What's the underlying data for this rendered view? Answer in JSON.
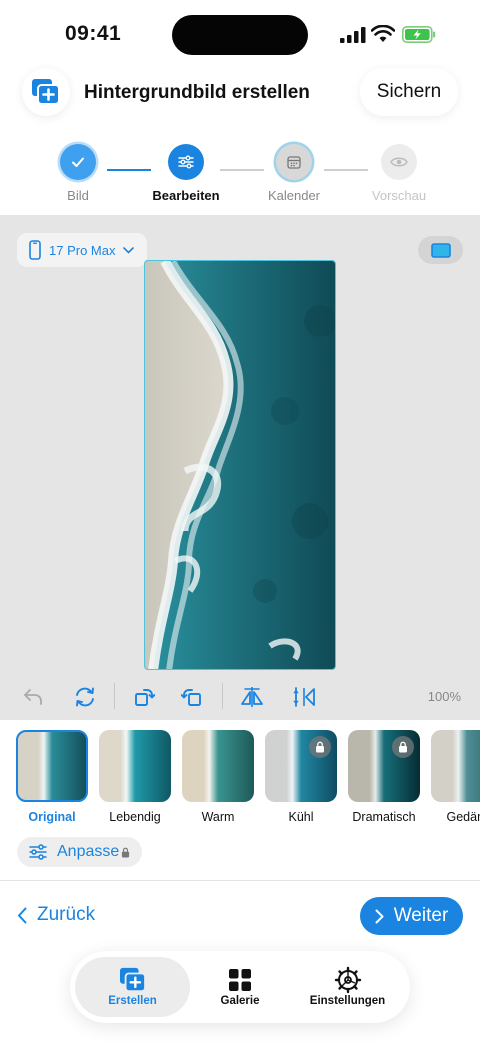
{
  "status": {
    "time": "09:41"
  },
  "header": {
    "title": "Hintergrundbild erstellen",
    "save_label": "Sichern"
  },
  "steps": [
    {
      "label": "Bild",
      "state": "done"
    },
    {
      "label": "Bearbeiten",
      "state": "active"
    },
    {
      "label": "Kalender",
      "state": "pending"
    },
    {
      "label": "Vorschau",
      "state": "disabled"
    }
  ],
  "editor": {
    "device": "17 Pro Max",
    "zoom": "100%"
  },
  "filters": [
    {
      "label": "Original",
      "selected": true,
      "locked": false
    },
    {
      "label": "Lebendig",
      "selected": false,
      "locked": false
    },
    {
      "label": "Warm",
      "selected": false,
      "locked": false
    },
    {
      "label": "Kühl",
      "selected": false,
      "locked": true
    },
    {
      "label": "Dramatisch",
      "selected": false,
      "locked": true
    },
    {
      "label": "Gedäm",
      "selected": false,
      "locked": false
    }
  ],
  "adjust": {
    "label": "Anpasse"
  },
  "nav": {
    "back_label": "Zurück",
    "next_label": "Weiter"
  },
  "tabbar": {
    "create": "Erstellen",
    "gallery": "Galerie",
    "settings": "Einstellungen"
  },
  "colors": {
    "accent": "#1a84e0",
    "water": "#1b6f7a",
    "sand": "#d8d3c6"
  }
}
